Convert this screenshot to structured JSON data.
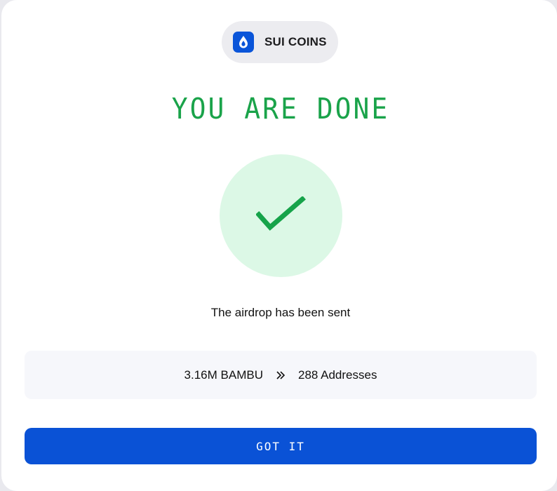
{
  "brand": {
    "name": "SUI COINS",
    "icon": "sui-droplet-icon",
    "color": "#0a55d9"
  },
  "status": {
    "title": "YOU ARE DONE",
    "icon": "checkmark-icon",
    "title_color": "#1aa34a",
    "circle_color": "#dcf8e6"
  },
  "message": "The airdrop has been sent",
  "summary": {
    "amount": "3.16M BAMBU",
    "separator_icon": "double-chevron-right-icon",
    "recipients": "288 Addresses"
  },
  "actions": {
    "confirm_label": "GOT IT",
    "confirm_color": "#0a52d6"
  }
}
